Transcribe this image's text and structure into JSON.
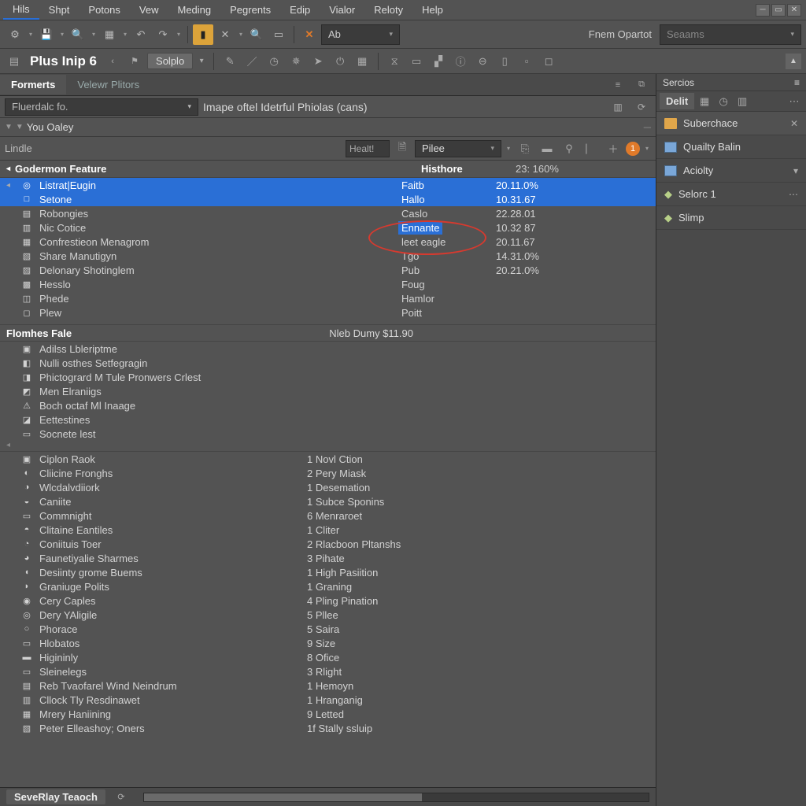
{
  "menu": [
    "Hils",
    "Shpt",
    "Potons",
    "Vew",
    "Meding",
    "Pegrents",
    "Edip",
    "Vialor",
    "Reloty",
    "Help"
  ],
  "toolbar1": {
    "combo_text": "Ab",
    "label_right": "Fnem Opartot",
    "search_placeholder": "Seaams"
  },
  "toolbar2": {
    "doc_title": "Plus Inip 6",
    "pill": "Solplo"
  },
  "main_tabs": [
    "Formerts",
    "Velewr Plitors"
  ],
  "filter": {
    "combo": "Fluerdalc fo.",
    "desc": "Imape oftel Idetrful Phiolas (cans)"
  },
  "sub_row": "You Oaley",
  "lin_row": {
    "left_label": "Lindle",
    "small_input": "Healt!",
    "combo": "Pilee",
    "badge": "1"
  },
  "section_a": {
    "title": "Godermon Feature",
    "col2": "Histhore",
    "col3": "23: 160%",
    "rows": [
      {
        "n": "Listrat|Eugin",
        "m": "Faitb",
        "v": "20.11.0%",
        "sel": true,
        "ic": "◎"
      },
      {
        "n": "Setone",
        "m": "Hallo",
        "v": "10.31.67",
        "sel": true,
        "midsel": true,
        "ic": "□"
      },
      {
        "n": "Robongies",
        "m": "Caslo",
        "v": "22.28.01",
        "ic": "▤"
      },
      {
        "n": "Nic Cotice",
        "m": "Ennante",
        "v": "10.32 87",
        "midsel": true,
        "ic": "▥"
      },
      {
        "n": "Confrestieon Menagrom",
        "m": "leet eagle",
        "v": "20.11.67",
        "ic": "▦"
      },
      {
        "n": "Share Manutigyn",
        "m": "Tgo",
        "v": "14.31.0%",
        "ic": "▧"
      },
      {
        "n": "Delonary Shotinglem",
        "m": "Pub",
        "v": "20.21.0%",
        "ic": "▨"
      },
      {
        "n": "Hesslo",
        "m": "Foug",
        "v": "",
        "ic": "▩"
      },
      {
        "n": "Phede",
        "m": "Hamlor",
        "v": "",
        "ic": "◫"
      },
      {
        "n": "Plew",
        "m": "Poitt",
        "v": "",
        "ic": "◻"
      }
    ]
  },
  "section_b": {
    "title": "Flomhes Fale",
    "extra": "Nleb Dumy $11.90",
    "rows": [
      {
        "n": "Adilss Lbleriptme",
        "ic": "▣"
      },
      {
        "n": "Nulli osthes Setfegragin",
        "ic": "◧"
      },
      {
        "n": "Phictogrard M Tule Pronwers Crlest",
        "ic": "◨"
      },
      {
        "n": "Men Elraniigs",
        "ic": "◩"
      },
      {
        "n": "Boch octaf Ml Inaage",
        "ic": "⚠"
      },
      {
        "n": "Eettestines",
        "ic": "◪"
      },
      {
        "n": "Socnete lest",
        "ic": "▭"
      }
    ]
  },
  "section_c": {
    "rows": [
      {
        "n": "Ciplon Raok",
        "m": "1 Novl Ction",
        "ic": "▣"
      },
      {
        "n": "Cliicine Fronghs",
        "m": "2 Pery Miask",
        "ic": "◐"
      },
      {
        "n": "Wlcdalvdiiork",
        "m": "1 Desemation",
        "ic": "◑"
      },
      {
        "n": "Caniite",
        "m": "1 Subce Sponins",
        "ic": "◒"
      },
      {
        "n": "Commnight",
        "m": "6 Menraroet",
        "ic": "▭"
      },
      {
        "n": "Clitaine Eantiles",
        "m": "1 Cliter",
        "ic": "◓"
      },
      {
        "n": "Coniituis Toer",
        "m": "2 Rlacboon Pltanshs",
        "ic": "◔"
      },
      {
        "n": "Faunetiyalie Sharmes",
        "m": "3 Pihate",
        "ic": "◕"
      },
      {
        "n": "Desiinty grome Buems",
        "m": "1 High Pasiition",
        "ic": "◖"
      },
      {
        "n": "Graniuge Polits",
        "m": "1 Graning",
        "ic": "◗"
      },
      {
        "n": "Cery Caples",
        "m": "4 Pling Pination",
        "ic": "◉"
      },
      {
        "n": "Dery YAligile",
        "m": "5 Pllee",
        "ic": "◎"
      },
      {
        "n": "Phorace",
        "m": "5 Saira",
        "ic": "○"
      },
      {
        "n": "Hlobatos",
        "m": "9 Size",
        "ic": "▭"
      },
      {
        "n": "Higininly",
        "m": "8 Ofice",
        "ic": "▬"
      },
      {
        "n": "Sleinelegs",
        "m": "3 Rlight",
        "ic": "▭"
      },
      {
        "n": "Reb Tvaofarel Wind Neindrum",
        "m": "1 Hemoyn",
        "ic": "▤"
      },
      {
        "n": "Cllock Tly Resdinawet",
        "m": "1 Hranganig",
        "ic": "▥"
      },
      {
        "n": "Mrery Haniining",
        "m": "9 Letted",
        "ic": "▦"
      },
      {
        "n": "Peter Elleashoy; Oners",
        "m": "1f Stally ssluip",
        "ic": "▧"
      }
    ]
  },
  "status": {
    "tab": "SeveRlay Teaoch"
  },
  "side": {
    "head": "Sercios",
    "tab": "Delit",
    "items": [
      {
        "label": "Suberchace",
        "type": "folder",
        "close": true
      },
      {
        "label": "Quailty Balin",
        "type": "doc"
      },
      {
        "label": "Aciolty",
        "type": "doc",
        "dd": true
      },
      {
        "label": "Selorc 1",
        "type": "gear",
        "more": true
      },
      {
        "label": "Slimp",
        "type": "gear"
      }
    ]
  }
}
